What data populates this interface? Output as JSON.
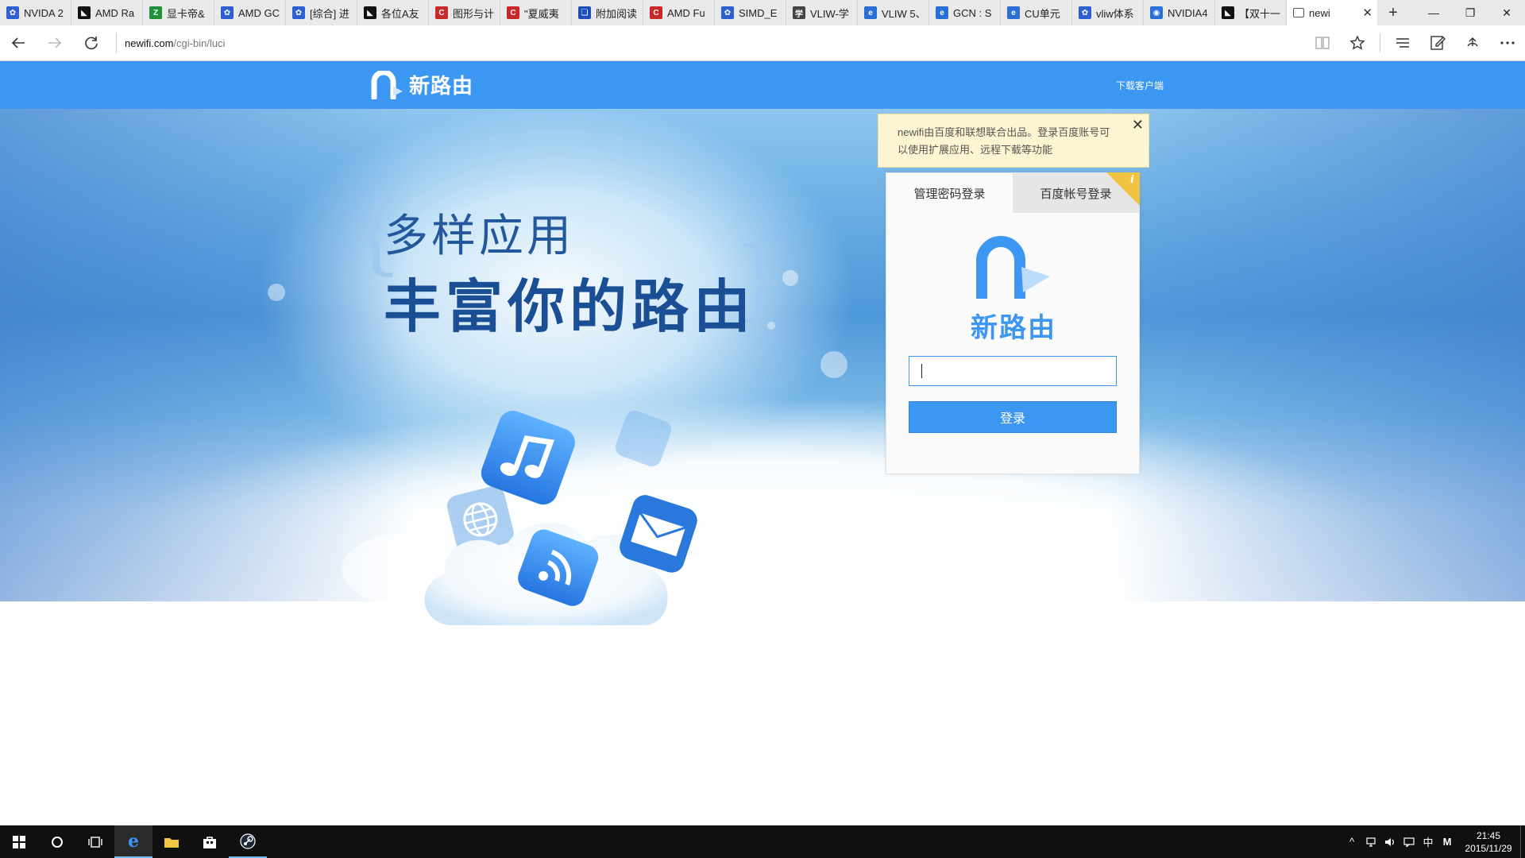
{
  "browser": {
    "tabs": [
      {
        "title": "NVIDA 2",
        "favicon": "paw-icon",
        "color": "#2d5fd3"
      },
      {
        "title": "AMD Ra",
        "favicon": "amd-icon",
        "color": "#111111"
      },
      {
        "title": "显卡帝&",
        "favicon": "zol-icon",
        "color": "#1f8f3a"
      },
      {
        "title": "AMD GC",
        "favicon": "paw-icon",
        "color": "#2d5fd3"
      },
      {
        "title": "[综合] 进",
        "favicon": "paw-icon",
        "color": "#2d5fd3"
      },
      {
        "title": "各位A友",
        "favicon": "amd-icon",
        "color": "#111111"
      },
      {
        "title": "图形与计",
        "favicon": "csdn-icon",
        "color": "#c8282a"
      },
      {
        "title": "\"夏威夷",
        "favicon": "csdn-icon",
        "color": "#c8282a"
      },
      {
        "title": "附加阅读",
        "favicon": "book-icon",
        "color": "#1f4fb8"
      },
      {
        "title": "AMD Fu",
        "favicon": "csdn-icon",
        "color": "#c8282a"
      },
      {
        "title": "SIMD_E",
        "favicon": "paw-icon",
        "color": "#2d5fd3"
      },
      {
        "title": "VLIW-学",
        "favicon": "xue-icon",
        "color": "#444444"
      },
      {
        "title": "VLIW 5、",
        "favicon": "e-icon",
        "color": "#2a6fd6"
      },
      {
        "title": "GCN : S",
        "favicon": "e-icon",
        "color": "#2a6fd6"
      },
      {
        "title": "CU单元",
        "favicon": "e-icon",
        "color": "#2a6fd6"
      },
      {
        "title": "vliw体系",
        "favicon": "paw-icon",
        "color": "#2d5fd3"
      },
      {
        "title": "NVIDIA4",
        "favicon": "eye-icon",
        "color": "#2a6fd6"
      },
      {
        "title": "【双十一",
        "favicon": "amd-icon",
        "color": "#111111"
      }
    ],
    "active_tab": {
      "title": "newi",
      "close": "✕"
    },
    "new_tab": "+",
    "window": {
      "minimize": "—",
      "restore": "❐",
      "close": "✕"
    },
    "url_host": "newifi.com",
    "url_path": "/cgi-bin/luci"
  },
  "site": {
    "brand": "新路由",
    "download_link": "下载客户端",
    "headline_1": "多样应用",
    "headline_2": "丰富你的路由",
    "notice": "newifi由百度和联想联合出品。登录百度账号可以使用扩展应用、远程下载等功能",
    "login": {
      "tab_password": "管理密码登录",
      "tab_baidu": "百度帐号登录",
      "corner_badge": "i",
      "logo_name": "新路由",
      "password_value": "",
      "submit": "登录"
    },
    "accent_color": "#3b97f1"
  },
  "taskbar": {
    "tray_ime": "中",
    "tray_m": "M",
    "clock_time": "21:45",
    "clock_date": "2015/11/29"
  }
}
